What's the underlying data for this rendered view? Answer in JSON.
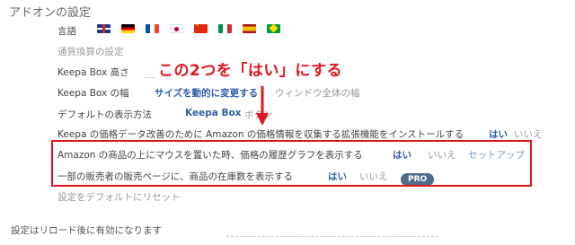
{
  "title": "アドオンの設定",
  "language": {
    "label": "言語",
    "flags": [
      "uk-flag-icon",
      "de-flag-icon",
      "fr-flag-icon",
      "jp-flag-icon",
      "cn-flag-icon",
      "it-flag-icon",
      "es-flag-icon",
      "br-flag-icon"
    ]
  },
  "currency": {
    "label": "通貨換算の設定"
  },
  "box_height": {
    "label": "Keepa Box 高さ"
  },
  "box_width": {
    "label": "Keepa Box の幅",
    "opt_auto": "サイズを動的に変更する",
    "opt_full": "ウィンドウ全体の幅"
  },
  "default_view": {
    "label": "デフォルトの表示方法",
    "opt_box": "Keepa Box",
    "opt_button": "ボタン"
  },
  "extension": {
    "label": "Keepa の価格データ改善のために Amazon の価格情報を収集する拡張機能をインストールする",
    "yes": "はい",
    "no": "いいえ"
  },
  "hover_graph": {
    "label": "Amazon の商品の上にマウスを置いた時、価格の履歴グラフを表示する",
    "yes": "はい",
    "no": "いいえ",
    "setup": "セットアップ"
  },
  "stock": {
    "label": "一部の販売者の販売ページに、商品の在庫数を表示する",
    "yes": "はい",
    "no": "いいえ",
    "pro": "PRO"
  },
  "reset": {
    "label": "設定をデフォルトにリセット"
  },
  "footer_note": "設定はリロード後に有効になります",
  "annotation": "この2つを「はい」にする",
  "colors": {
    "accent": "#2f5fa8",
    "annotation": "#e0161e",
    "pro_badge": "#4f6c89"
  }
}
